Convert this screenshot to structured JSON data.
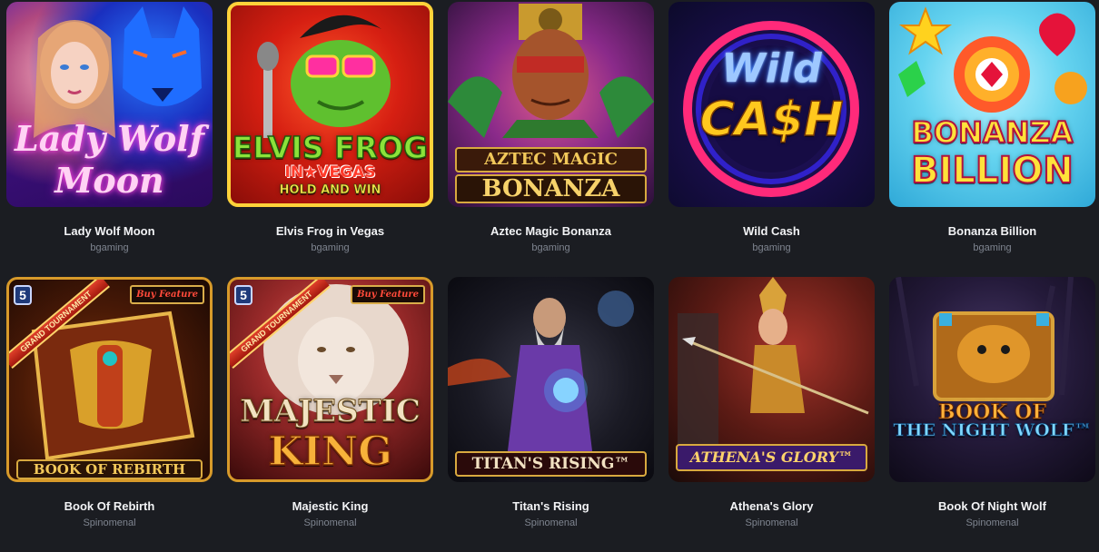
{
  "games": [
    {
      "name": "Lady Wolf Moon",
      "provider": "bgaming",
      "art_lines": [
        "Lady Wolf",
        "Moon"
      ]
    },
    {
      "name": "Elvis Frog in Vegas",
      "provider": "bgaming",
      "art_lines": [
        "ELVIS FROG",
        "IN★VEGAS",
        "HOLD AND WIN"
      ]
    },
    {
      "name": "Aztec Magic Bonanza",
      "provider": "bgaming",
      "art_lines": [
        "AZTEC MAGIC",
        "BONANZA"
      ]
    },
    {
      "name": "Wild Cash",
      "provider": "bgaming",
      "art_lines": [
        "Wild",
        "CA$H"
      ]
    },
    {
      "name": "Bonanza Billion",
      "provider": "bgaming",
      "art_lines": [
        "BONANZA",
        "BILLION"
      ]
    },
    {
      "name": "Book Of Rebirth",
      "provider": "Spinomenal",
      "art_lines": [
        "BOOK OF REBIRTH"
      ],
      "grand": "GRAND TOURNAMENT",
      "buy": "Buy Feature",
      "badge": "5"
    },
    {
      "name": "Majestic King",
      "provider": "Spinomenal",
      "art_lines": [
        "MAJESTIC",
        "KING"
      ],
      "grand": "GRAND TOURNAMENT",
      "buy": "Buy Feature",
      "badge": "5"
    },
    {
      "name": "Titan's Rising",
      "provider": "Spinomenal",
      "art_lines": [
        "TITAN'S RISING™"
      ]
    },
    {
      "name": "Athena's Glory",
      "provider": "Spinomenal",
      "art_lines": [
        "ATHENA'S GLORY™"
      ]
    },
    {
      "name": "Book Of Night Wolf",
      "provider": "Spinomenal",
      "art_lines": [
        "BOOK OF",
        "THE NIGHT WOLF™"
      ]
    }
  ],
  "colors": {
    "background": "#1b1d22",
    "name_text": "#f2f3f5",
    "provider_text": "#7f8590"
  }
}
